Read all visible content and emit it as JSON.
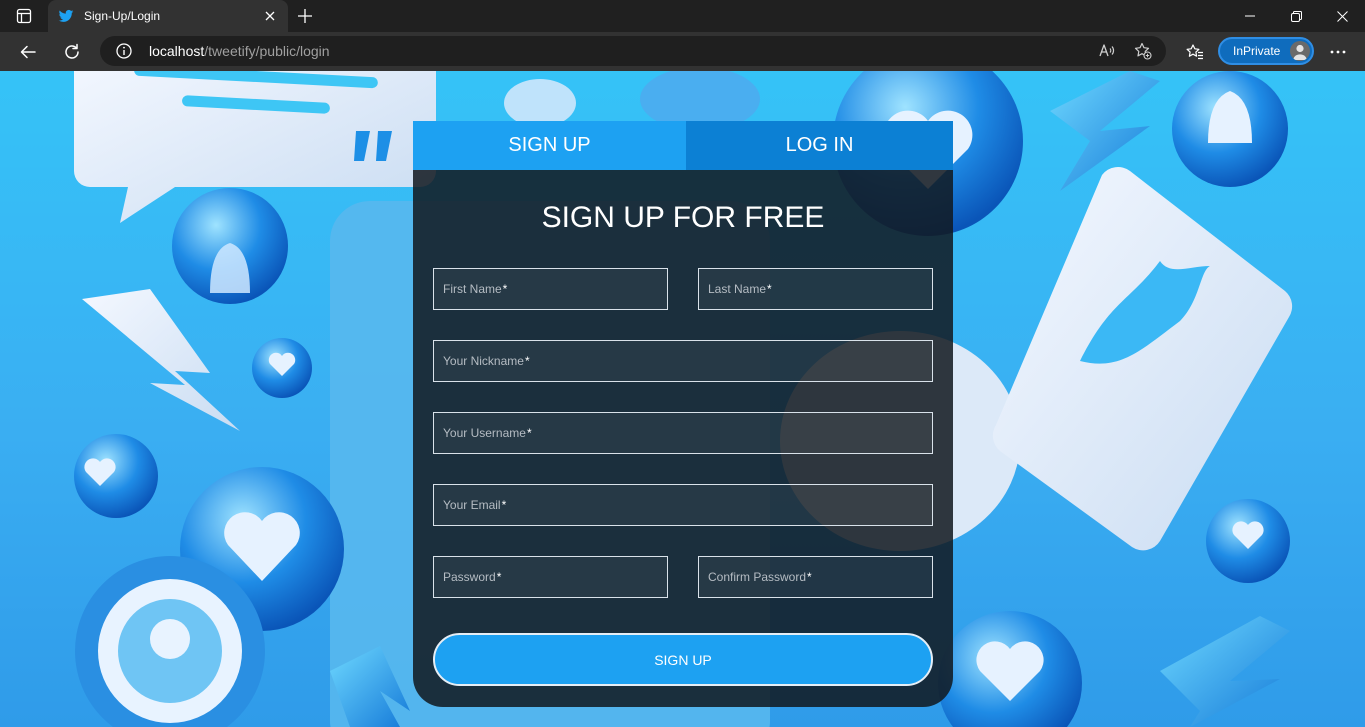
{
  "browser": {
    "tab_title": "Sign-Up/Login",
    "url_host": "localhost",
    "url_path": "/tweetify/public/login",
    "inprivate_label": "InPrivate"
  },
  "icons": {
    "tabs": "tab-actions-icon",
    "favicon": "twitter-bird-icon",
    "close": "close-icon",
    "new_tab": "plus-icon",
    "minimize": "minimize-icon",
    "restore": "restore-icon",
    "window_close": "close-icon",
    "back": "arrow-left-icon",
    "refresh": "refresh-icon",
    "site_info": "info-icon",
    "read_aloud": "read-aloud-icon",
    "add_favorite": "star-plus-icon",
    "favorites": "favorites-icon",
    "more": "ellipsis-icon"
  },
  "auth": {
    "tab_signup": "SIGN UP",
    "tab_login": "LOG IN",
    "title": "SIGN UP FOR FREE",
    "required_mark": "*",
    "fields": {
      "first_name": "First Name",
      "last_name": "Last Name",
      "nickname": "Your Nickname",
      "username": "Your Username",
      "email": "Your Email",
      "password": "Password",
      "confirm_password": "Confirm Password"
    },
    "submit_label": "SIGN UP"
  },
  "colors": {
    "accent": "#1da1f2",
    "tab_inactive": "#0c80d4",
    "card_bg": "#11181f",
    "page_bg_top": "#35c3f7",
    "page_bg_bottom": "#2f9be9"
  }
}
